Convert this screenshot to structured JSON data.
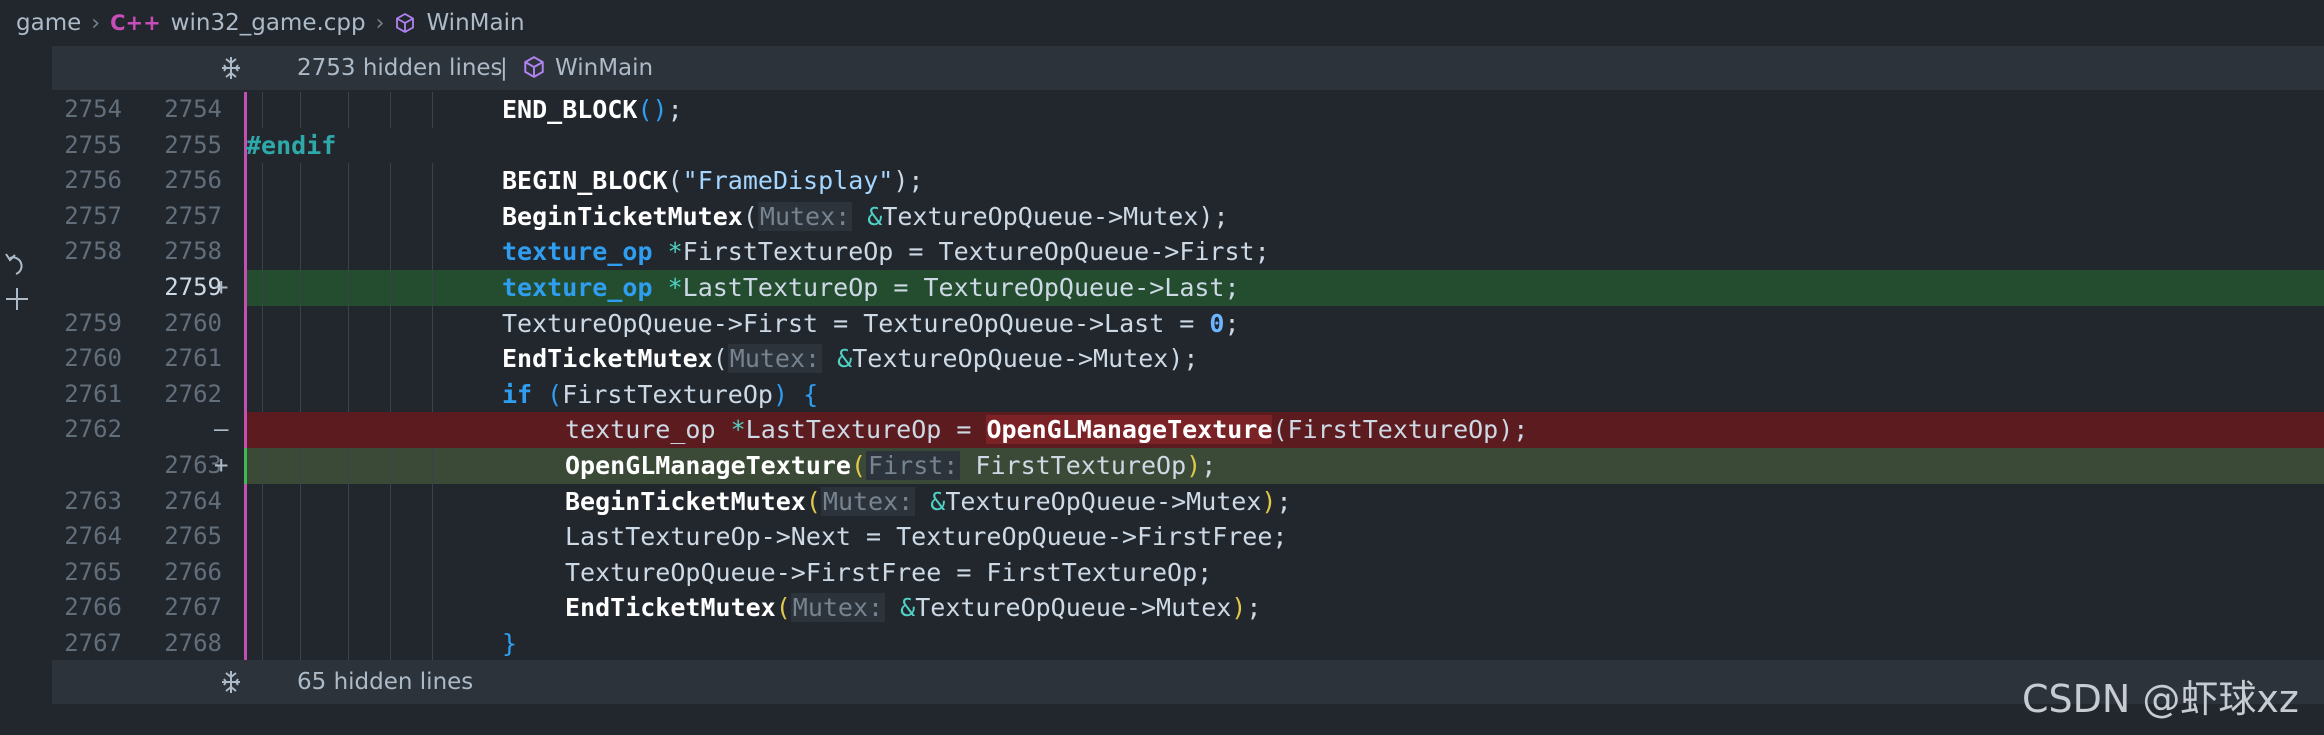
{
  "breadcrumb": {
    "root": "game",
    "file_badge": "C++",
    "file": "win32_game.cpp",
    "symbol": "WinMain"
  },
  "fold_top": {
    "label": "2753 hidden lines",
    "separator": "|",
    "symbol": "WinMain"
  },
  "fold_bottom": {
    "label": "65 hidden lines"
  },
  "watermark": "CSDN @虾球xz",
  "lines": [
    {
      "old": "2754",
      "new": "2754",
      "marker": "",
      "type": "normal",
      "indent": 5
    },
    {
      "old": "2755",
      "new": "2755",
      "marker": "",
      "type": "normal",
      "indent": 0
    },
    {
      "old": "2756",
      "new": "2756",
      "marker": "",
      "type": "normal",
      "indent": 5
    },
    {
      "old": "2757",
      "new": "2757",
      "marker": "",
      "type": "normal",
      "indent": 5
    },
    {
      "old": "2758",
      "new": "2758",
      "marker": "",
      "type": "normal",
      "indent": 5
    },
    {
      "old": "",
      "new": "2759",
      "marker": "+",
      "type": "added",
      "indent": 5
    },
    {
      "old": "2759",
      "new": "2760",
      "marker": "",
      "type": "normal",
      "indent": 5
    },
    {
      "old": "2760",
      "new": "2761",
      "marker": "",
      "type": "normal",
      "indent": 5
    },
    {
      "old": "2761",
      "new": "2762",
      "marker": "",
      "type": "normal",
      "indent": 5
    },
    {
      "old": "2762",
      "new": "",
      "marker": "—",
      "type": "removed",
      "indent": 6
    },
    {
      "old": "",
      "new": "2763",
      "marker": "+",
      "type": "added-inner",
      "indent": 6
    },
    {
      "old": "2763",
      "new": "2764",
      "marker": "",
      "type": "normal",
      "indent": 6
    },
    {
      "old": "2764",
      "new": "2765",
      "marker": "",
      "type": "normal",
      "indent": 6
    },
    {
      "old": "2765",
      "new": "2766",
      "marker": "",
      "type": "normal",
      "indent": 6
    },
    {
      "old": "2766",
      "new": "2767",
      "marker": "",
      "type": "normal",
      "indent": 6
    },
    {
      "old": "2767",
      "new": "2768",
      "marker": "",
      "type": "normal",
      "indent": 5
    }
  ],
  "code": [
    [
      [
        "fn",
        "END_BLOCK"
      ],
      [
        "paren",
        "()"
      ],
      [
        "txt",
        ";"
      ]
    ],
    [
      [
        "pre",
        "#endif"
      ]
    ],
    [
      [
        "fn",
        "BEGIN_BLOCK"
      ],
      [
        "txt",
        "("
      ],
      [
        "str",
        "\"FrameDisplay\""
      ],
      [
        "txt",
        ");"
      ]
    ],
    [
      [
        "fn",
        "BeginTicketMutex"
      ],
      [
        "txt",
        "("
      ],
      [
        "hint",
        "Mutex:"
      ],
      [
        "txt",
        " "
      ],
      [
        "op",
        "&"
      ],
      [
        "txt",
        "TextureOpQueue->Mutex);"
      ]
    ],
    [
      [
        "kw",
        "texture_op"
      ],
      [
        "txt",
        " "
      ],
      [
        "op",
        "*"
      ],
      [
        "txt",
        "FirstTextureOp = TextureOpQueue->First;"
      ]
    ],
    [
      [
        "kw",
        "texture_op"
      ],
      [
        "txt",
        " "
      ],
      [
        "op",
        "*"
      ],
      [
        "txt",
        "LastTextureOp = TextureOpQueue->Last;"
      ]
    ],
    [
      [
        "txt",
        "TextureOpQueue->First = TextureOpQueue->Last = "
      ],
      [
        "num",
        "0"
      ],
      [
        "txt",
        ";"
      ]
    ],
    [
      [
        "fn",
        "EndTicketMutex"
      ],
      [
        "txt",
        "("
      ],
      [
        "hint",
        "Mutex:"
      ],
      [
        "txt",
        " "
      ],
      [
        "op",
        "&"
      ],
      [
        "txt",
        "TextureOpQueue->Mutex);"
      ]
    ],
    [
      [
        "kw",
        "if"
      ],
      [
        "txt",
        " "
      ],
      [
        "paren",
        "("
      ],
      [
        "txt",
        "FirstTextureOp"
      ],
      [
        "paren",
        ")"
      ],
      [
        "txt",
        " "
      ],
      [
        "paren",
        "{"
      ]
    ],
    [
      [
        "txt",
        "texture_op "
      ],
      [
        "op",
        "*"
      ],
      [
        "txt",
        "LastTextureOp = "
      ],
      [
        "fn",
        "OpenGLManageTexture"
      ],
      [
        "txt",
        "(FirstTextureOp);"
      ]
    ],
    [
      [
        "fn",
        "OpenGLManageTexture"
      ],
      [
        "paren-y",
        "("
      ],
      [
        "hint",
        "First:"
      ],
      [
        "txt",
        " FirstTextureOp"
      ],
      [
        "paren-y",
        ")"
      ],
      [
        "txt",
        ";"
      ]
    ],
    [
      [
        "fn",
        "BeginTicketMutex"
      ],
      [
        "paren-y",
        "("
      ],
      [
        "hint",
        "Mutex:"
      ],
      [
        "txt",
        " "
      ],
      [
        "op",
        "&"
      ],
      [
        "txt",
        "TextureOpQueue->Mutex"
      ],
      [
        "paren-y",
        ")"
      ],
      [
        "txt",
        ";"
      ]
    ],
    [
      [
        "txt",
        "LastTextureOp->Next = TextureOpQueue->FirstFree;"
      ]
    ],
    [
      [
        "txt",
        "TextureOpQueue->FirstFree = FirstTextureOp;"
      ]
    ],
    [
      [
        "fn",
        "EndTicketMutex"
      ],
      [
        "paren-y",
        "("
      ],
      [
        "hint",
        "Mutex:"
      ],
      [
        "txt",
        " "
      ],
      [
        "op",
        "&"
      ],
      [
        "txt",
        "TextureOpQueue->Mutex"
      ],
      [
        "paren-y",
        ")"
      ],
      [
        "txt",
        ";"
      ]
    ],
    [
      [
        "paren",
        "}"
      ]
    ]
  ]
}
